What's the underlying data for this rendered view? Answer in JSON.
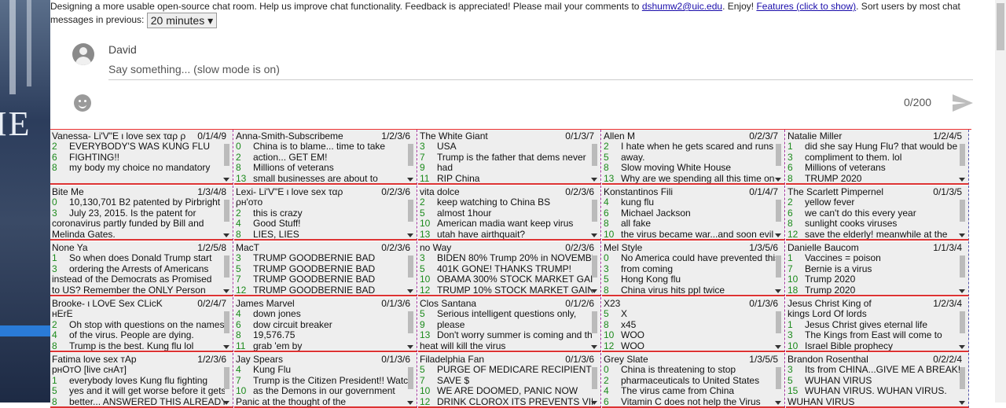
{
  "header": {
    "intro": "Designing a more usable open-source chat room. Help us improve chat functionality. Feedback is appreciated! Please mail your comments to",
    "email": "dshumw2@uic.edu",
    "enjoy": ". Enjoy!",
    "features_link": "Features (click to show)",
    "sort_text": ". Sort users by most chat messages in previous:",
    "time_select": "20 minutes"
  },
  "composer": {
    "username": "David",
    "placeholder": "Say something... (slow mode is on)",
    "counter": "0/200"
  },
  "icons": {
    "avatar": "account-circle-icon",
    "emoji": "emoji-icon",
    "send": "send-icon",
    "dropdown": "caret-down-icon"
  },
  "colors": {
    "accent_red": "#dd3333",
    "dashed_purple": "#a0309a",
    "count_green": "#1b8a1b"
  },
  "cells": [
    {
      "name": "Vanessa- Li'V\"E ι love sex ταρ ρн'ото",
      "counts": "0/1/4/9",
      "msgs": [
        {
          "n": "2",
          "t": "EVERYBODY'S WAS KUNG FLU"
        },
        {
          "n": "6",
          "t": "FIGHTING!!"
        },
        {
          "n": "8",
          "t": "my body my choice no mandatory"
        }
      ]
    },
    {
      "name": "Anna-Smith-Subscribeme",
      "counts": "1/2/3/6",
      "msgs": [
        {
          "n": "0",
          "t": "China is to blame... time to take"
        },
        {
          "n": "2",
          "t": "action... GET EM!"
        },
        {
          "n": "8",
          "t": "Millions of veterans"
        },
        {
          "n": "13",
          "t": "small businesses are about to"
        }
      ]
    },
    {
      "name": "The White Giant",
      "counts": "0/1/3/7",
      "msgs": [
        {
          "n": "3",
          "t": "USA"
        },
        {
          "n": "7",
          "t": "Trump is the father that dems never"
        },
        {
          "n": "9",
          "t": "had"
        },
        {
          "n": "11",
          "t": "RIP China"
        }
      ]
    },
    {
      "name": "Allen M",
      "counts": "0/2/3/7",
      "msgs": [
        {
          "n": "2",
          "t": "I hate when he gets scared and runs"
        },
        {
          "n": "5",
          "t": "away."
        },
        {
          "n": "8",
          "t": "Slow moving White House"
        },
        {
          "n": "13",
          "t": "Why are we spending all this time on a"
        }
      ]
    },
    {
      "name": "Natalie Miller",
      "counts": "1/2/4/5",
      "msgs": [
        {
          "n": "1",
          "t": "did she say Hung Flu? that would be a"
        },
        {
          "n": "3",
          "t": "compliment to them. lol"
        },
        {
          "n": "6",
          "t": "Millions of veterans"
        },
        {
          "n": "8",
          "t": "TRUMP 2020"
        }
      ]
    },
    {
      "name": "Bite Me",
      "counts": "1/3/4/8",
      "msgs": [
        {
          "n": "0",
          "t": "10,130,701 B2 patented by Pirbright"
        },
        {
          "n": "3",
          "t": "July 23, 2015. Is the patent for"
        },
        {
          "n": "",
          "t": "coronavirus partly funded by Bill and"
        },
        {
          "n": "",
          "t": "Melinda Gates."
        }
      ]
    },
    {
      "name": "Lexi- Li'V\"E ι love sex ταρ",
      "counts": "0/2/3/6",
      "msgs": [
        {
          "n": "",
          "t": "ρн'ото"
        },
        {
          "n": "2",
          "t": "this is crazy"
        },
        {
          "n": "4",
          "t": "Good Stuff!"
        },
        {
          "n": "8",
          "t": "LIES, LIES"
        }
      ]
    },
    {
      "name": "vita dolce",
      "counts": "0/2/3/6",
      "msgs": [
        {
          "n": "2",
          "t": "keep watching to China BS"
        },
        {
          "n": "5",
          "t": "almost 1hour"
        },
        {
          "n": "10",
          "t": "American madia want keep virus"
        },
        {
          "n": "13",
          "t": "utah have airthquait?"
        }
      ]
    },
    {
      "name": "Konstantinos Fili",
      "counts": "0/1/4/7",
      "msgs": [
        {
          "n": "4",
          "t": "kung flu"
        },
        {
          "n": "6",
          "t": "Michael Jackson"
        },
        {
          "n": "8",
          "t": "all fake"
        },
        {
          "n": "10",
          "t": "the virus became war...and soon evil"
        }
      ]
    },
    {
      "name": "The Scarlett Pimpernel",
      "counts": "0/1/3/5",
      "msgs": [
        {
          "n": "2",
          "t": "yellow fever"
        },
        {
          "n": "6",
          "t": "we can't do this every year"
        },
        {
          "n": "8",
          "t": "sunlight cooks viruses"
        },
        {
          "n": "12",
          "t": "save the elderly! meanwhile at the"
        }
      ]
    },
    {
      "name": "None Ya",
      "counts": "1/2/5/8",
      "msgs": [
        {
          "n": "1",
          "t": "So when does Donald Trump start"
        },
        {
          "n": "3",
          "t": "ordering the Arrests of Americans"
        },
        {
          "n": "",
          "t": "instead of the Democrats as Promised"
        },
        {
          "n": "",
          "t": "to US? Remember the ONLY Person"
        }
      ]
    },
    {
      "name": "MacT",
      "counts": "0/2/3/6",
      "msgs": [
        {
          "n": "3",
          "t": "TRUMP GOODBERNIE BAD"
        },
        {
          "n": "5",
          "t": "TRUMP GOODBERNIE BAD"
        },
        {
          "n": "7",
          "t": "TRUMP GOODBERNIE BAD"
        },
        {
          "n": "12",
          "t": "TRUMP GOODBERNIE BAD"
        }
      ]
    },
    {
      "name": "no Way",
      "counts": "0/2/3/6",
      "msgs": [
        {
          "n": "3",
          "t": "BIDEN 80% Trump 20% in NOVEMBER"
        },
        {
          "n": "5",
          "t": "401K GONE! THANKS TRUMP!"
        },
        {
          "n": "10",
          "t": "OBAMA 300% STOCK MARKET GAIN -"
        },
        {
          "n": "12",
          "t": "TRUMP 10% STOCK MARKET GAIN"
        }
      ]
    },
    {
      "name": "Mel Style",
      "counts": "1/3/5/6",
      "msgs": [
        {
          "n": "0",
          "t": "No America could have prevented this"
        },
        {
          "n": "3",
          "t": "from coming"
        },
        {
          "n": "5",
          "t": "Hong Kong flu"
        },
        {
          "n": "8",
          "t": "China virus hits ppl twice"
        }
      ]
    },
    {
      "name": "Danielle Baucom",
      "counts": "1/1/3/4",
      "msgs": [
        {
          "n": "1",
          "t": "Vaccines = poison"
        },
        {
          "n": "7",
          "t": "Bernie is a virus"
        },
        {
          "n": "10",
          "t": "Trump 2020"
        },
        {
          "n": "18",
          "t": "Trump 2020"
        }
      ]
    },
    {
      "name": "Brooke- ι LOvE Sex CLicK",
      "counts": "0/2/4/7",
      "msgs": [
        {
          "n": "",
          "t": "нЕrЕ"
        },
        {
          "n": "2",
          "t": "Oh stop with questions on the names"
        },
        {
          "n": "4",
          "t": "of the virus. People are dying."
        },
        {
          "n": "8",
          "t": "Trump is the best. Kung flu lol"
        }
      ]
    },
    {
      "name": "James Marvel",
      "counts": "0/1/3/6",
      "msgs": [
        {
          "n": "4",
          "t": "down jones"
        },
        {
          "n": "6",
          "t": "dow circuit breaker"
        },
        {
          "n": "8",
          "t": "19,576.75"
        },
        {
          "n": "11",
          "t": "grab 'em by"
        }
      ]
    },
    {
      "name": "Clos Santana",
      "counts": "0/1/2/6",
      "msgs": [
        {
          "n": "5",
          "t": "Serious intelligent questions only,"
        },
        {
          "n": "9",
          "t": "please"
        },
        {
          "n": "13",
          "t": "Don't worry summer is coming and the"
        },
        {
          "n": "",
          "t": "heat will kill the virus"
        }
      ]
    },
    {
      "name": "X23",
      "counts": "0/1/3/6",
      "msgs": [
        {
          "n": "5",
          "t": "X"
        },
        {
          "n": "8",
          "t": "x45"
        },
        {
          "n": "10",
          "t": "WOO"
        },
        {
          "n": "12",
          "t": "WOO"
        }
      ]
    },
    {
      "name": "Jesus Christ King of",
      "counts": "1/2/3/4",
      "msgs": [
        {
          "n": "",
          "t": "kings Lord Of lords"
        },
        {
          "n": "1",
          "t": "Jesus Christ gives eternal life"
        },
        {
          "n": "3",
          "t": "The Kings from East will come to"
        },
        {
          "n": "10",
          "t": "Israel Bible prophecy"
        }
      ]
    },
    {
      "name": "Fatima love sex тAp",
      "counts": "1/2/3/6",
      "msgs": [
        {
          "n": "",
          "t": "рнОтО [live cнAт]"
        },
        {
          "n": "1",
          "t": "everybody loves Kung flu fighting"
        },
        {
          "n": "5",
          "t": "yes and it will get worse before it gets"
        },
        {
          "n": "8",
          "t": "better... ANSWERED THIS ALREADY!!!"
        }
      ]
    },
    {
      "name": "Jay Spears",
      "counts": "0/1/3/6",
      "msgs": [
        {
          "n": "4",
          "t": "Kung Flu"
        },
        {
          "n": "7",
          "t": "Trump is the Citizen President!! Watch"
        },
        {
          "n": "10",
          "t": "as the Demons in our government"
        },
        {
          "n": "",
          "t": "Panic at the thought of the"
        }
      ]
    },
    {
      "name": "Filadelphia Fan",
      "counts": "0/1/3/6",
      "msgs": [
        {
          "n": "5",
          "t": "PURGE OF MEDICARE RECIPIENTS TO"
        },
        {
          "n": "7",
          "t": "SAVE $"
        },
        {
          "n": "10",
          "t": "WE ARE DOOMED, PANIC NOW"
        },
        {
          "n": "12",
          "t": "DRINK CLOROX ITS PREVENTS VIRUS"
        }
      ]
    },
    {
      "name": "Grey Slate",
      "counts": "1/3/5/5",
      "msgs": [
        {
          "n": "0",
          "t": "China is threatening to stop"
        },
        {
          "n": "2",
          "t": "pharmaceuticals to United States"
        },
        {
          "n": "4",
          "t": "The virus came from China"
        },
        {
          "n": "6",
          "t": "Vitamin C does not help the Virus"
        }
      ]
    },
    {
      "name": "Brandon Rosenthal",
      "counts": "0/2/2/4",
      "msgs": [
        {
          "n": "3",
          "t": "Its from CHINA...GIVE ME A BREAK!!!"
        },
        {
          "n": "5",
          "t": "WUHAN VIRUS"
        },
        {
          "n": "15",
          "t": "WUHAN VIRUS. WUHAN VIRUS."
        },
        {
          "n": "",
          "t": "WUHAN VIRUS"
        }
      ]
    }
  ]
}
